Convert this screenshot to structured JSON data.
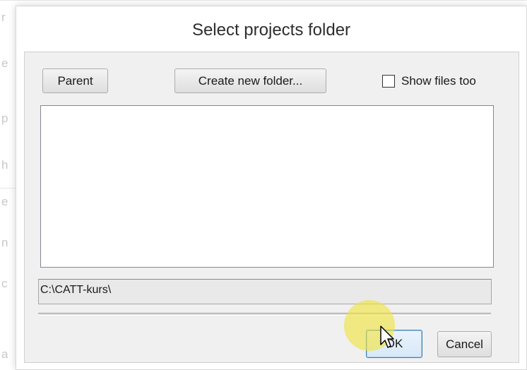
{
  "dialog": {
    "title": "Select projects folder",
    "parent_label": "Parent",
    "create_folder_label": "Create new folder...",
    "show_files_label": "Show files too",
    "show_files_checked": false,
    "path_value": "C:\\CATT-kurs\\",
    "ok_label": "OK",
    "cancel_label": "Cancel"
  },
  "background_glyphs": [
    "r",
    "e",
    "p",
    "h",
    "e",
    "n",
    "c",
    "a"
  ],
  "icons": {
    "cursor": "arrow-cursor-icon",
    "highlight": "click-highlight"
  },
  "colors": {
    "dialog_bg": "#f0f0f0",
    "ok_border": "#3c7fb1",
    "highlight": "#f0e43c"
  }
}
